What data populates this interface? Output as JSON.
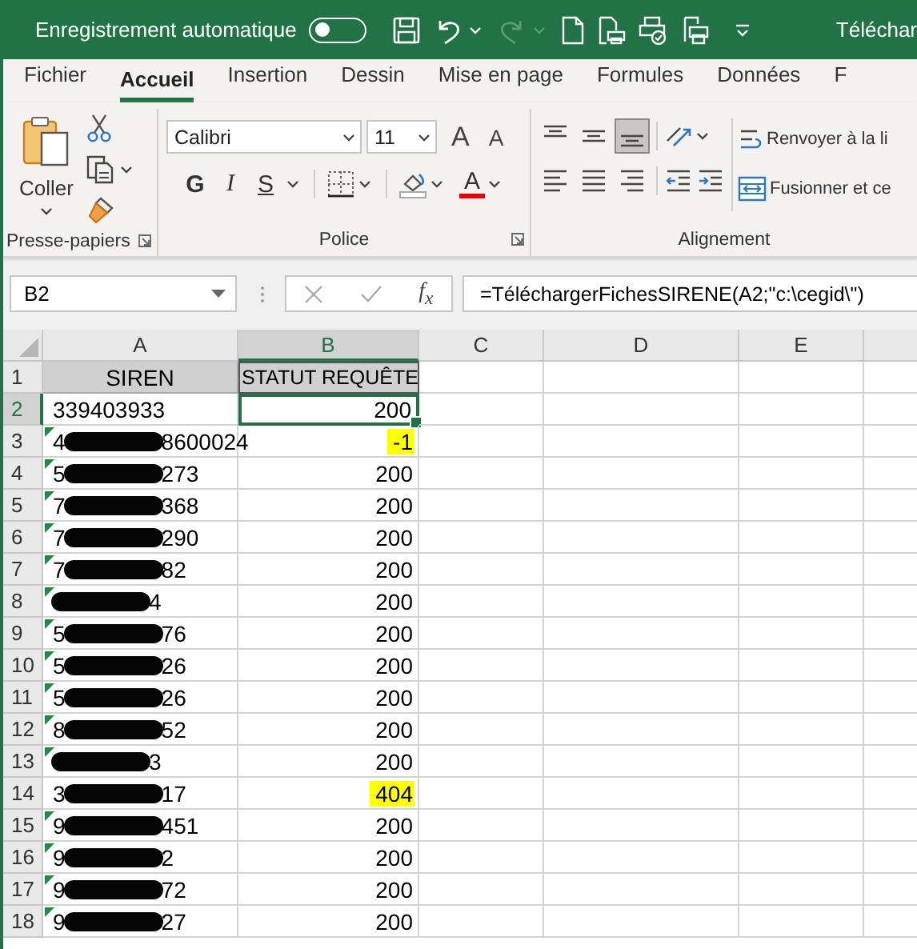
{
  "title_bar": {
    "autosave_label": "Enregistrement automatique",
    "autosave_on": false,
    "redo_disabled": true,
    "title": "Téléchar"
  },
  "tabs": [
    {
      "label": "Fichier",
      "selected": false
    },
    {
      "label": "Accueil",
      "selected": true
    },
    {
      "label": "Insertion",
      "selected": false
    },
    {
      "label": "Dessin",
      "selected": false
    },
    {
      "label": "Mise en page",
      "selected": false
    },
    {
      "label": "Formules",
      "selected": false
    },
    {
      "label": "Données",
      "selected": false
    },
    {
      "label": "F",
      "selected": false
    }
  ],
  "ribbon": {
    "clipboard": {
      "paste_label": "Coller",
      "group_label": "Presse-papiers"
    },
    "font": {
      "font_name": "Calibri",
      "font_size": "11",
      "grow_label": "A",
      "shrink_label": "A",
      "bold_label": "G",
      "italic_label": "I",
      "underline_label": "S",
      "color_label": "A",
      "group_label": "Police"
    },
    "alignment": {
      "vertical": [
        {
          "kind": "top",
          "selected": false
        },
        {
          "kind": "middle",
          "selected": false
        },
        {
          "kind": "bottom",
          "selected": true
        }
      ],
      "horizontal": [
        {
          "kind": "left",
          "selected": false
        },
        {
          "kind": "center",
          "selected": false
        },
        {
          "kind": "right",
          "selected": false
        }
      ],
      "wrap_label": "Renvoyer à la li",
      "merge_label": "Fusionner et ce",
      "group_label": "Alignement"
    }
  },
  "formula_bar": {
    "name_box": "B2",
    "function_label": "f$_{x}$",
    "formula": "=TéléchargerFichesSIRENE(A2;\"c:\\cegid\\\")"
  },
  "sheet": {
    "columns": [
      {
        "label": "A",
        "selected": false
      },
      {
        "label": "B",
        "selected": true
      },
      {
        "label": "C",
        "selected": false
      },
      {
        "label": "D",
        "selected": false
      },
      {
        "label": "E",
        "selected": false
      }
    ],
    "header_row": {
      "number": "1",
      "cells": [
        "SIREN",
        "STATUT REQUÊTE"
      ]
    },
    "rows": [
      {
        "number": "2",
        "selected": true,
        "siren": {
          "prefix": "339403933",
          "redacted": false,
          "warning": false
        },
        "status": {
          "value": "200",
          "highlighted": false,
          "selected": true
        }
      },
      {
        "number": "3",
        "selected": false,
        "siren": {
          "prefix": "4",
          "suffix": "8600024",
          "redacted": true,
          "warning": true
        },
        "status": {
          "value": "-1",
          "highlighted": true,
          "selected": false
        }
      },
      {
        "number": "4",
        "selected": false,
        "siren": {
          "prefix": "5",
          "suffix": "273",
          "redacted": true,
          "warning": true
        },
        "status": {
          "value": "200",
          "highlighted": false,
          "selected": false
        }
      },
      {
        "number": "5",
        "selected": false,
        "siren": {
          "prefix": "7",
          "suffix": "368",
          "redacted": true,
          "warning": true
        },
        "status": {
          "value": "200",
          "highlighted": false,
          "selected": false
        }
      },
      {
        "number": "6",
        "selected": false,
        "siren": {
          "prefix": "7",
          "suffix": "290",
          "redacted": true,
          "warning": true
        },
        "status": {
          "value": "200",
          "highlighted": false,
          "selected": false
        }
      },
      {
        "number": "7",
        "selected": false,
        "siren": {
          "prefix": "7",
          "suffix": "82",
          "redacted": true,
          "warning": true
        },
        "status": {
          "value": "200",
          "highlighted": false,
          "selected": false
        }
      },
      {
        "number": "8",
        "selected": false,
        "siren": {
          "suffix": "4",
          "redacted": true,
          "warning": true
        },
        "status": {
          "value": "200",
          "highlighted": false,
          "selected": false
        }
      },
      {
        "number": "9",
        "selected": false,
        "siren": {
          "prefix": "5",
          "suffix": "76",
          "redacted": true,
          "warning": true
        },
        "status": {
          "value": "200",
          "highlighted": false,
          "selected": false
        }
      },
      {
        "number": "10",
        "selected": false,
        "siren": {
          "prefix": "5",
          "suffix": "26",
          "redacted": true,
          "warning": true
        },
        "status": {
          "value": "200",
          "highlighted": false,
          "selected": false
        }
      },
      {
        "number": "11",
        "selected": false,
        "siren": {
          "prefix": "5",
          "suffix": "26",
          "redacted": true,
          "warning": true
        },
        "status": {
          "value": "200",
          "highlighted": false,
          "selected": false
        }
      },
      {
        "number": "12",
        "selected": false,
        "siren": {
          "prefix": "8",
          "suffix": "52",
          "redacted": true,
          "warning": true
        },
        "status": {
          "value": "200",
          "highlighted": false,
          "selected": false
        }
      },
      {
        "number": "13",
        "selected": false,
        "siren": {
          "suffix": "3",
          "redacted": true,
          "warning": true
        },
        "status": {
          "value": "200",
          "highlighted": false,
          "selected": false
        }
      },
      {
        "number": "14",
        "selected": false,
        "siren": {
          "prefix": "3",
          "suffix": "17",
          "redacted": true,
          "warning": false
        },
        "status": {
          "value": "404",
          "highlighted": true,
          "selected": false
        }
      },
      {
        "number": "15",
        "selected": false,
        "siren": {
          "prefix": "9",
          "suffix": "451",
          "redacted": true,
          "warning": true
        },
        "status": {
          "value": "200",
          "highlighted": false,
          "selected": false
        }
      },
      {
        "number": "16",
        "selected": false,
        "siren": {
          "prefix": "9",
          "suffix": "2",
          "redacted": true,
          "warning": true
        },
        "status": {
          "value": "200",
          "highlighted": false,
          "selected": false
        }
      },
      {
        "number": "17",
        "selected": false,
        "siren": {
          "prefix": "9",
          "suffix": "72",
          "redacted": true,
          "warning": true
        },
        "status": {
          "value": "200",
          "highlighted": false,
          "selected": false
        }
      },
      {
        "number": "18",
        "selected": false,
        "siren": {
          "prefix": "9",
          "suffix": "27",
          "redacted": true,
          "warning": true
        },
        "status": {
          "value": "200",
          "highlighted": false,
          "selected": false
        }
      }
    ]
  }
}
